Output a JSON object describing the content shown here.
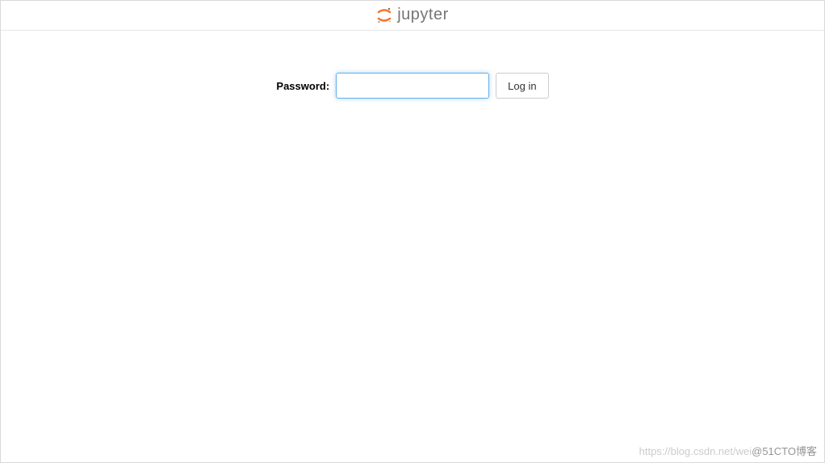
{
  "header": {
    "brand_text": "jupyter",
    "logo_name": "jupyter-logo"
  },
  "login": {
    "password_label": "Password:",
    "password_value": "",
    "login_button_label": "Log in"
  },
  "watermark": {
    "faint": "https://blog.csdn.net/wei",
    "dark": "@51CTO博客"
  }
}
